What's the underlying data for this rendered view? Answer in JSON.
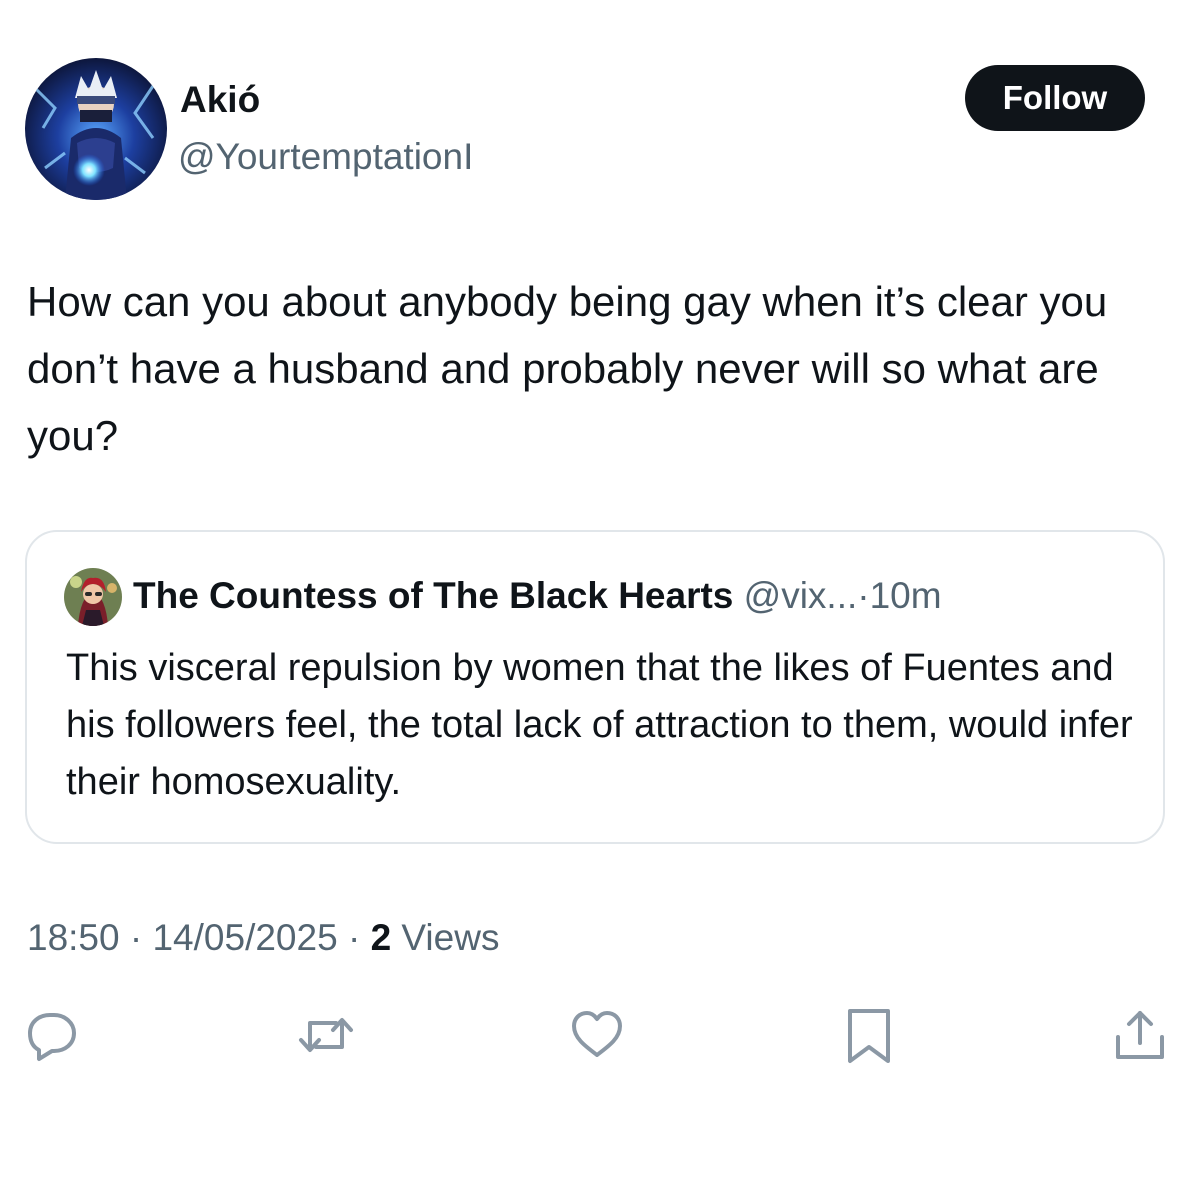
{
  "author": {
    "display_name": "Akió",
    "handle": "@YourtemptationI",
    "avatar_icon": "anime-character-avatar"
  },
  "follow_button": {
    "label": "Follow"
  },
  "tweet": {
    "text": "How can you about anybody being gay when it’s clear you don’t have a husband and probably never will so what are you?"
  },
  "quoted_tweet": {
    "display_name": "The Countess of The Black Hearts",
    "handle": "@vix...",
    "separator": "·",
    "time": "10m",
    "text": "This visceral repulsion by women that the likes of Fuentes and his followers feel, the total lack of attraction to them, would infer their homosexuality.",
    "avatar_icon": "illustrated-woman-avatar"
  },
  "meta": {
    "time": "18:50",
    "sep1": "·",
    "date": "14/05/2025",
    "sep2": "·",
    "views_count": "2",
    "views_label": "Views"
  },
  "actions": {
    "icons": [
      "reply-icon",
      "repost-icon",
      "like-icon",
      "bookmark-icon",
      "share-icon"
    ],
    "icon_color": "#8b98a5"
  },
  "colors": {
    "text_primary": "#0f1419",
    "text_secondary": "#536471",
    "button_bg": "#0f1419",
    "border": "#e1e6ea"
  }
}
